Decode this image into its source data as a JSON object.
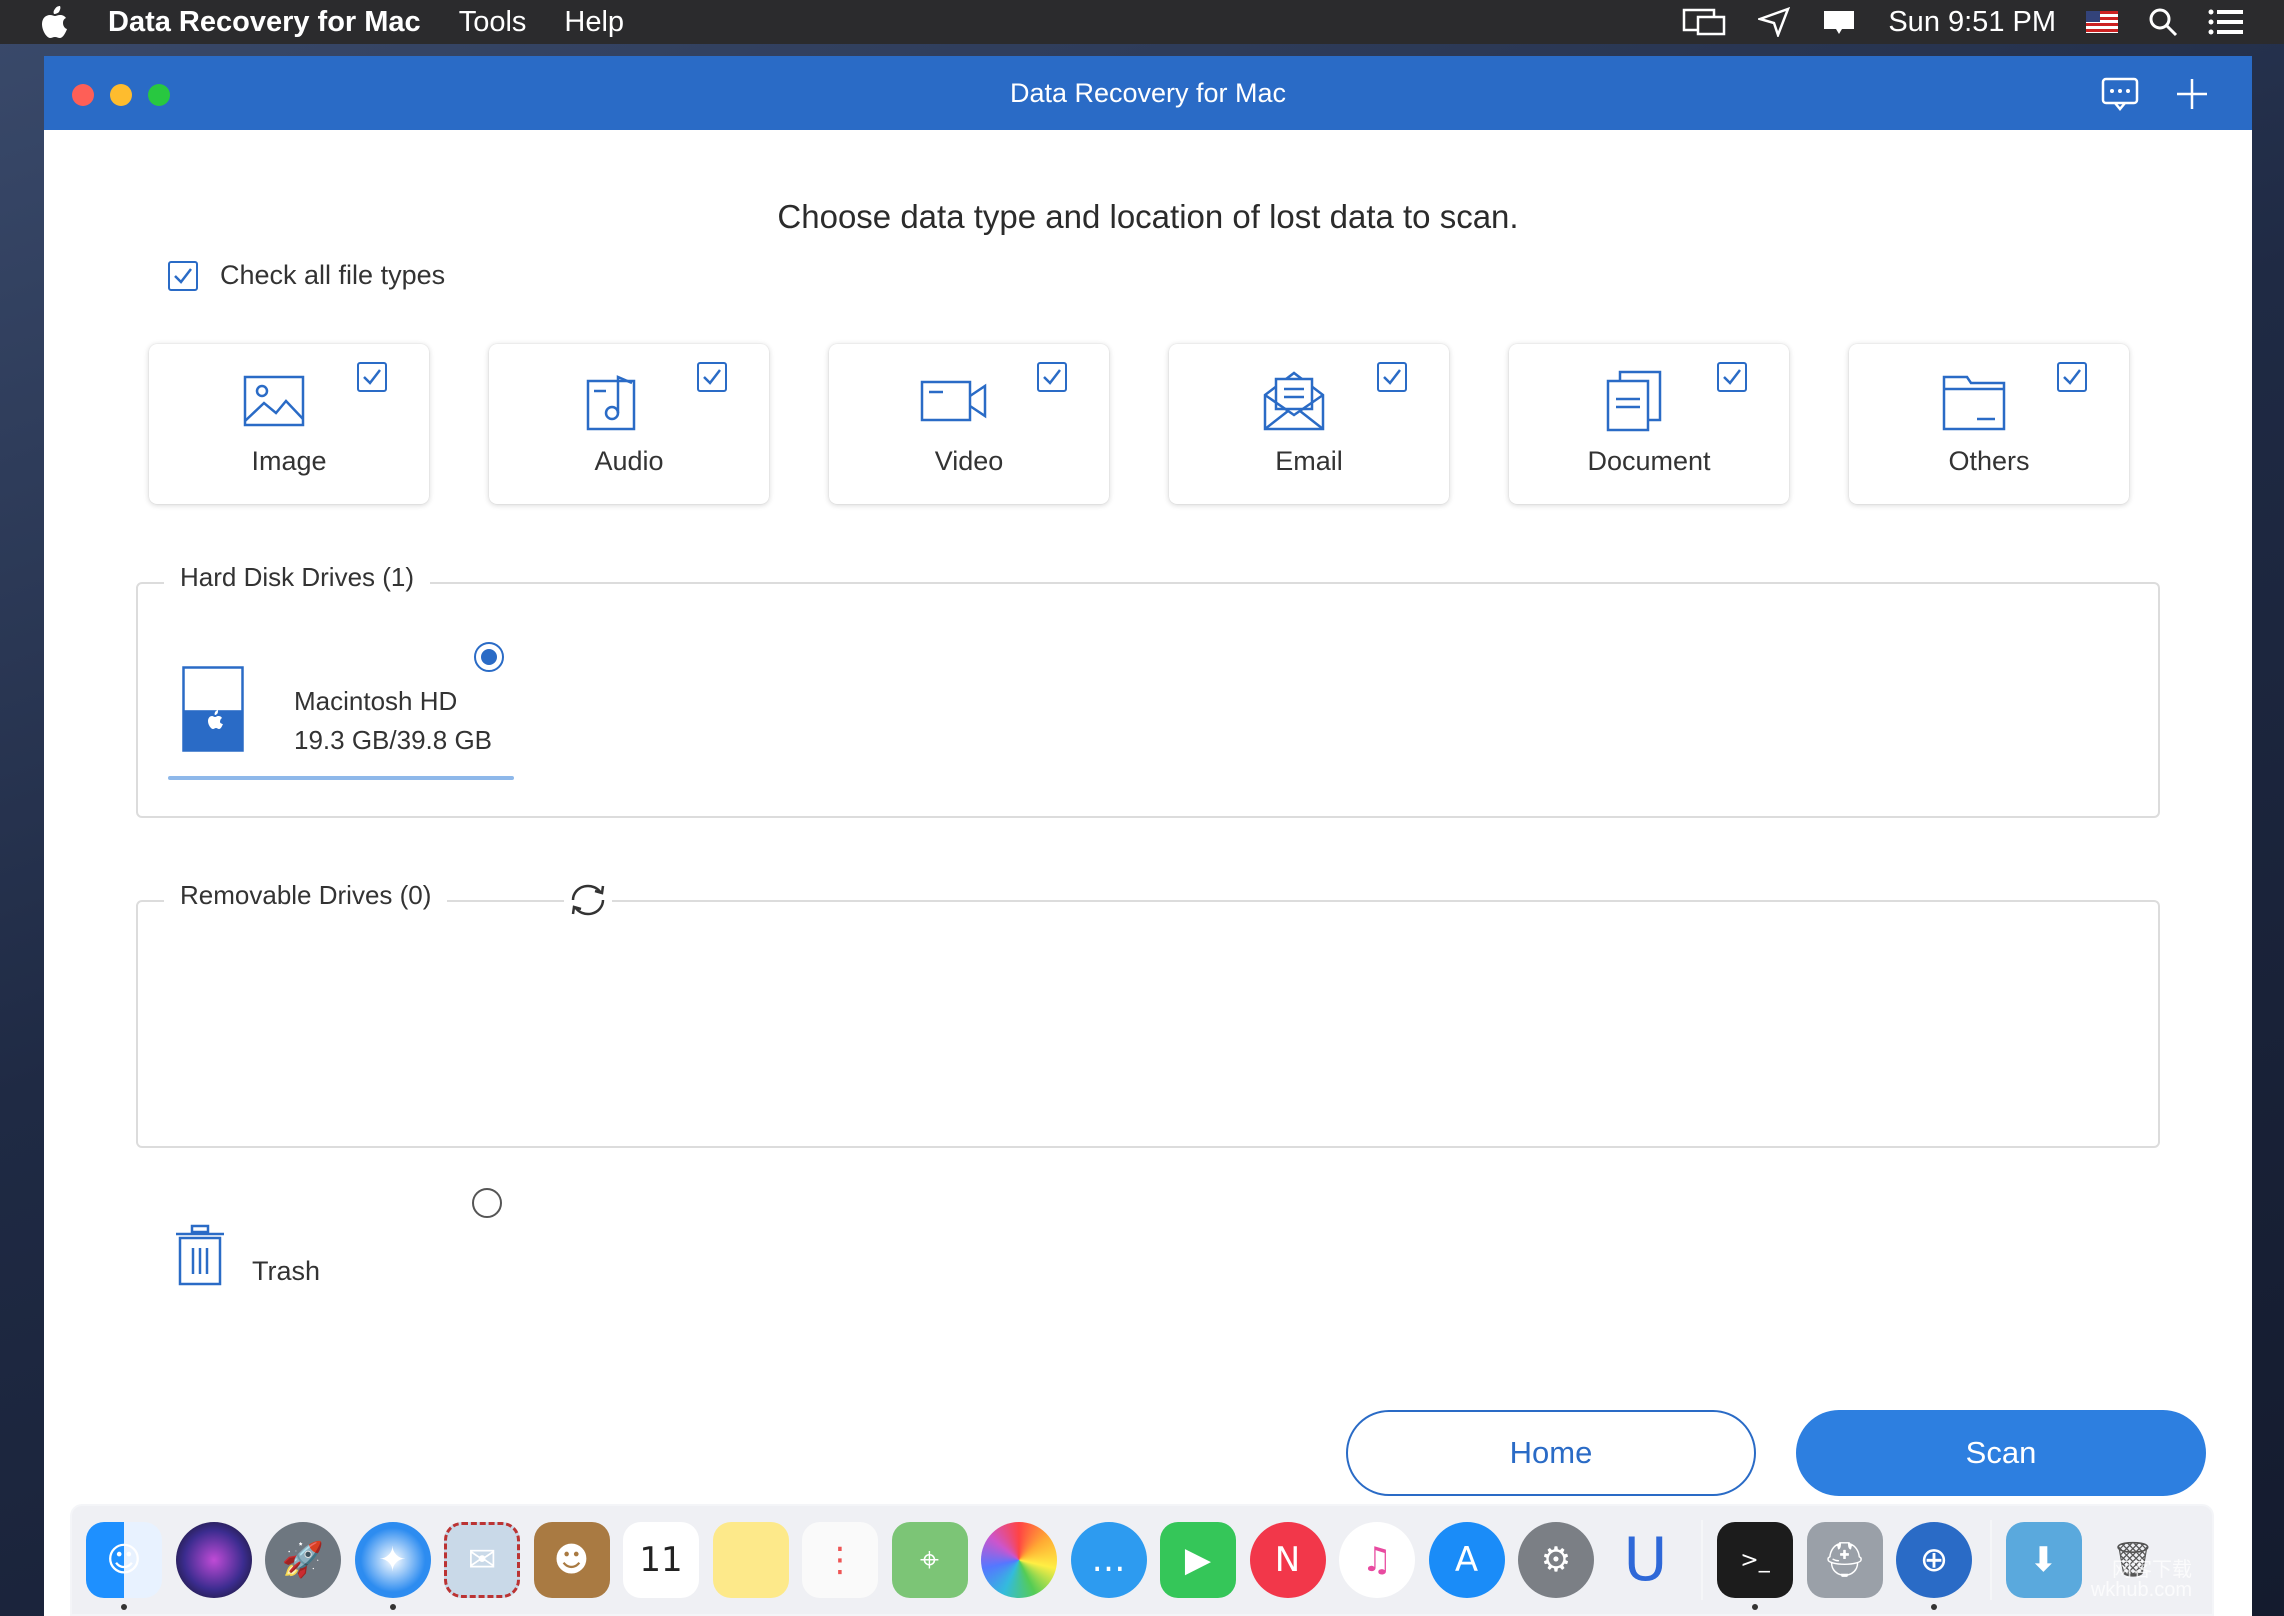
{
  "menubar": {
    "app_name": "Data Recovery for Mac",
    "menu_items": [
      "Tools",
      "Help"
    ],
    "clock": "Sun 9:51 PM"
  },
  "window": {
    "title": "Data Recovery for Mac"
  },
  "main": {
    "heading": "Choose data type and location of lost data to scan.",
    "check_all_label": "Check all file types",
    "check_all_checked": true,
    "file_types": [
      {
        "label": "Image",
        "icon": "image-icon",
        "checked": true
      },
      {
        "label": "Audio",
        "icon": "audio-icon",
        "checked": true
      },
      {
        "label": "Video",
        "icon": "video-icon",
        "checked": true
      },
      {
        "label": "Email",
        "icon": "email-icon",
        "checked": true
      },
      {
        "label": "Document",
        "icon": "document-icon",
        "checked": true
      },
      {
        "label": "Others",
        "icon": "folder-icon",
        "checked": true
      }
    ]
  },
  "hard_disk": {
    "legend": "Hard Disk Drives (1)",
    "drives": [
      {
        "name": "Macintosh HD",
        "size": "19.3 GB/39.8 GB",
        "selected": true,
        "used_fraction": 0.485
      }
    ]
  },
  "removable": {
    "legend": "Removable Drives (0)",
    "refresh_icon": "refresh-icon"
  },
  "trash": {
    "label": "Trash",
    "selected": false
  },
  "buttons": {
    "home": "Home",
    "scan": "Scan"
  },
  "watermark": {
    "line1": "网客下载",
    "line2": "wkhub.com"
  },
  "colors": {
    "accent": "#2a6bc6",
    "scan_button": "#2d7fe0",
    "titlebar": "#2a6bc6"
  }
}
